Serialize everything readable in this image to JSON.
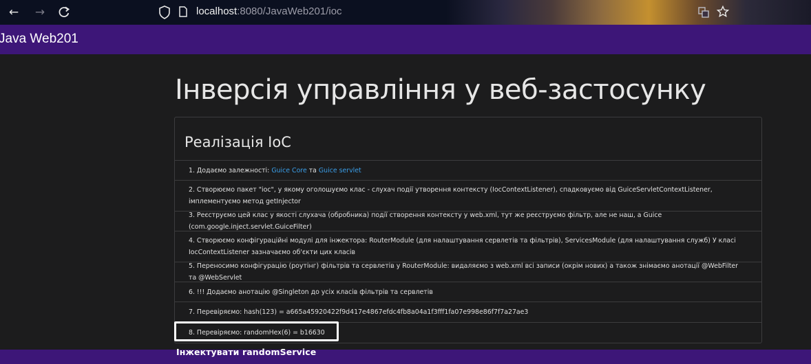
{
  "browser": {
    "url_host": "localhost",
    "url_rest": ":8080/JavaWeb201/ioc"
  },
  "navbar": {
    "brand": "Java Web201"
  },
  "page": {
    "title": "Інверсія управління у веб-застосунку"
  },
  "card": {
    "header": "Реалізація IoC",
    "items": [
      {
        "prefix": "1. Додаємо залежності: ",
        "link1": "Guice Core",
        "mid": " та ",
        "link2": "Guice servlet"
      },
      {
        "text": "2. Створюємо пакет \"ioc\", у якому оголошуємо клас - слухач події утворення контексту (IocContextListener), спадковуємо від GuiceServletContextListener, імплементуємо метод getInjector"
      },
      {
        "text": "3. Реєструємо цей клас у якості слухача (обробника) події створення контексту у web.xml, тут же реєструємо фільтр, але не наш, а Guice (com.google.inject.servlet.GuiceFilter)"
      },
      {
        "text": "4. Створюємо конфігураційні модулі для інжектора: RouterModule (для налаштування сервлетів та фільтрів), ServicesModule (для налаштування служб) У класі IocContextListener зазначаємо об'єкти цих класів"
      },
      {
        "text": "5. Переносимо конфігурацію (роутінг) фільтрів та сервлетів у RouterModule: видаляємо з web.xml всі записи (окрім нових) а також знімаємо анотації @WebFilter та @WebServlet"
      },
      {
        "text": "6. !!! Додаємо анотацію @Singleton до усіх класів фільтрів та сервлетів"
      },
      {
        "text": "7. Перевіряємо: hash(123) = a665a45920422f9d417e4867efdc4fb8a04a1f3fff1fa07e998e86f7f7a27ae3"
      },
      {
        "text": "8. Перевіряємо: randomHex(6) = b16630"
      }
    ]
  },
  "footer": {
    "inject_label": "Інжектувати randomService"
  },
  "colors": {
    "navbar": "#3d1678",
    "link": "#3a9ee8",
    "background": "#1c1c1d"
  }
}
